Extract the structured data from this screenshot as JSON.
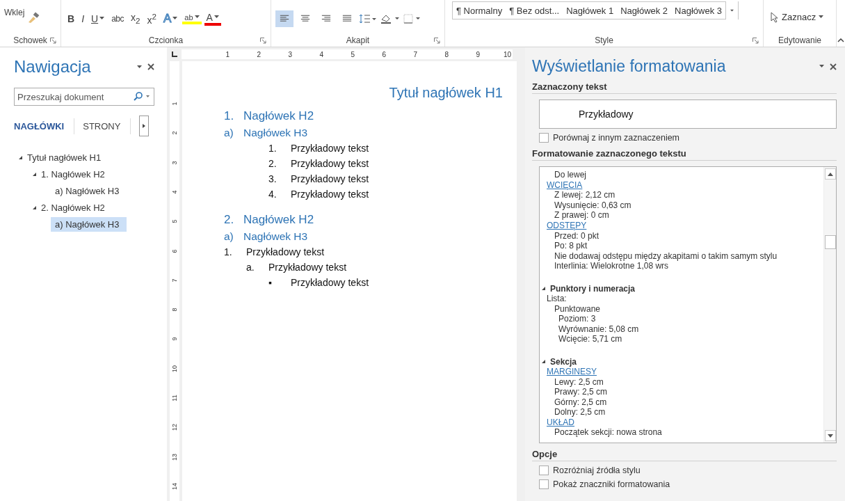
{
  "ribbon": {
    "clipboard": {
      "label": "Schowek",
      "paste": "Wklej"
    },
    "font": {
      "label": "Czcionka",
      "buttons": [
        {
          "text": "B",
          "kind": "bold"
        },
        {
          "text": "I",
          "kind": "italic"
        },
        {
          "text": "U",
          "kind": "underline"
        },
        {
          "text": "abc",
          "kind": "strike"
        },
        {
          "text": "x$_{2}$",
          "kind": "sub"
        },
        {
          "text": "x$^{2}$",
          "kind": "sup"
        },
        {
          "text": "A",
          "kind": "effects"
        },
        {
          "text": "ab",
          "kind": "highlight"
        },
        {
          "text": "A",
          "kind": "color"
        }
      ]
    },
    "paragraph": {
      "label": "Akapit",
      "align": [
        {
          "selected": true
        },
        {
          "selected": false
        },
        {
          "selected": false
        },
        {
          "selected": false
        }
      ]
    },
    "styles": {
      "label": "Style",
      "items": [
        "¶ Normalny",
        "¶ Bez odst...",
        "Nagłówek 1",
        "Nagłówek 2",
        "Nagłówek 3"
      ]
    },
    "editing": {
      "label": "Edytowanie",
      "select": "Zaznacz"
    }
  },
  "navigation": {
    "title": "Nawigacja",
    "search": {
      "placeholder": "Przeszukaj dokument"
    },
    "tabs": [
      {
        "label": "NAGŁÓWKI",
        "selected": true
      },
      {
        "label": "STRONY",
        "selected": false
      }
    ],
    "tree": [
      {
        "label": "Tytuł nagłówek H1",
        "expanded": true,
        "selected": false,
        "children": [
          {
            "label": "1. Nagłówek H2",
            "expanded": true,
            "selected": false,
            "children": [
              {
                "label": "a) Nagłówek H3",
                "selected": false
              }
            ]
          },
          {
            "label": "2. Nagłówek H2",
            "expanded": true,
            "selected": false,
            "children": [
              {
                "label": "a) Nagłówek H3",
                "selected": true
              }
            ]
          }
        ]
      }
    ]
  },
  "ruler": {
    "marks": [
      "1",
      "2",
      "3",
      "4",
      "5",
      "6",
      "7",
      "8",
      "9",
      "10"
    ],
    "vertical_marks": [
      "1",
      "2",
      "3",
      "4",
      "5",
      "6",
      "7",
      "8",
      "9",
      "10",
      "11",
      "12",
      "13",
      "14"
    ]
  },
  "document": {
    "title": "Tytuł nagłówek H1",
    "blocks": [
      {
        "kind": "h2",
        "marker": "1.",
        "text": "Nagłówek H2"
      },
      {
        "kind": "h3",
        "marker": "a)",
        "text": "Nagłówek H3"
      },
      {
        "kind": "deep-list",
        "items": [
          {
            "marker": "1.",
            "text": "Przykładowy tekst"
          },
          {
            "marker": "2.",
            "text": "Przykładowy tekst"
          },
          {
            "marker": "3.",
            "text": "Przykładowy tekst"
          },
          {
            "marker": "4.",
            "text": "Przykładowy tekst"
          }
        ]
      },
      {
        "kind": "h2",
        "marker": "2.",
        "text": "Nagłówek H2"
      },
      {
        "kind": "h3",
        "marker": "a)",
        "text": "Nagłówek H3"
      },
      {
        "kind": "list",
        "items": [
          {
            "marker": "1.",
            "text": "Przykładowy tekst",
            "children": [
              {
                "marker": "a.",
                "text": "Przykładowy tekst",
                "children": [
                  {
                    "marker": "▪",
                    "text": "Przykładowy tekst"
                  }
                ]
              }
            ]
          }
        ]
      }
    ]
  },
  "formatting": {
    "title": "Wyświetlanie formatowania",
    "selected_section": "Zaznaczony tekst",
    "preview": "Przykładowy",
    "compare": {
      "label": "Porównaj z innym zaznaczeniem",
      "checked": false
    },
    "details_section": "Formatowanie zaznaczonego tekstu",
    "details": [
      {
        "kind": "value",
        "text": "Do lewej"
      },
      {
        "kind": "link",
        "text": "WCIĘCIA"
      },
      {
        "kind": "value",
        "text": "Z lewej:  2,12 cm"
      },
      {
        "kind": "value",
        "text": "Wysunięcie:  0,63 cm"
      },
      {
        "kind": "value",
        "text": "Z prawej:  0 cm"
      },
      {
        "kind": "link",
        "text": "ODSTĘPY"
      },
      {
        "kind": "value",
        "text": "Przed:  0 pkt"
      },
      {
        "kind": "value",
        "text": "Po:  8 pkt"
      },
      {
        "kind": "value",
        "text": "Nie dodawaj odstępu między akapitami o takim samym stylu"
      },
      {
        "kind": "value",
        "text": "Interlinia:  Wielokrotne 1,08 wrs"
      },
      {
        "kind": "group",
        "text": "Punktory i numeracja"
      },
      {
        "kind": "label",
        "text": "Lista:"
      },
      {
        "kind": "value",
        "text": "Punktowane"
      },
      {
        "kind": "subvalue",
        "text": "Poziom: 3"
      },
      {
        "kind": "subvalue",
        "text": "Wyrównanie:  5,08 cm"
      },
      {
        "kind": "subvalue",
        "text": "Wcięcie:  5,71 cm"
      },
      {
        "kind": "group",
        "text": "Sekcja"
      },
      {
        "kind": "link",
        "text": "MARGINESY"
      },
      {
        "kind": "value",
        "text": "Lewy:  2,5 cm"
      },
      {
        "kind": "value",
        "text": "Prawy:  2,5 cm"
      },
      {
        "kind": "value",
        "text": "Górny:  2,5 cm"
      },
      {
        "kind": "value",
        "text": "Dolny:  2,5 cm"
      },
      {
        "kind": "link",
        "text": "UKŁAD"
      },
      {
        "kind": "value",
        "text": "Początek sekcji: nowa strona"
      }
    ],
    "options_section": "Opcje",
    "options": [
      {
        "label": "Rozróżniaj źródła stylu",
        "checked": false
      },
      {
        "label": "Pokaż znaczniki formatowania",
        "checked": false
      }
    ]
  }
}
